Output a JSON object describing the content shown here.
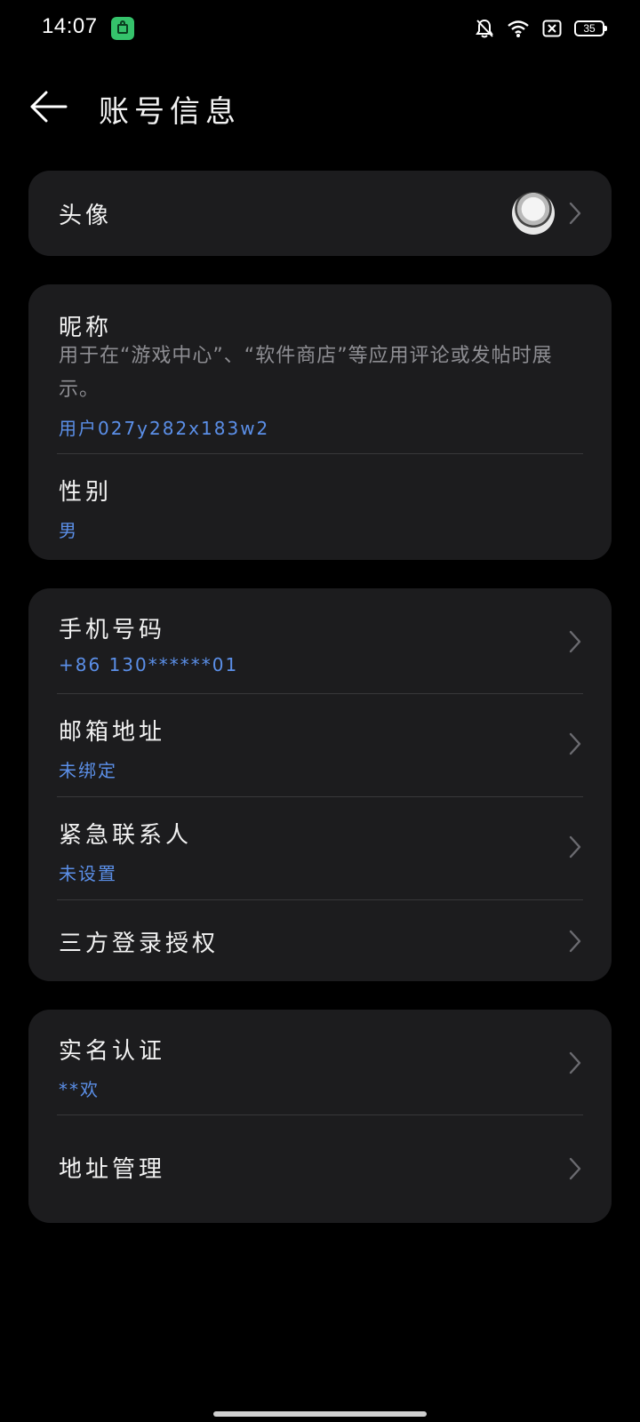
{
  "status_bar": {
    "time": "14:07",
    "battery": "35",
    "icons": [
      "shopping-bag-icon",
      "bell-muted-icon",
      "wifi-icon",
      "sim-cross-icon",
      "battery-icon"
    ]
  },
  "header": {
    "title": "账号信息",
    "back_icon": "arrow-left-icon"
  },
  "cards": {
    "avatar": {
      "label": "头像"
    },
    "nickname": {
      "label": "昵称",
      "description": "用于在“游戏中心”、“软件商店”等应用评论或发帖时展示。",
      "value": "用户027y282x183w2"
    },
    "gender": {
      "label": "性别",
      "value": "男"
    },
    "phone": {
      "label": "手机号码",
      "value": "+86 130******01"
    },
    "email": {
      "label": "邮箱地址",
      "value": "未绑定"
    },
    "emergency": {
      "label": "紧急联系人",
      "value": "未设置"
    },
    "third_party": {
      "label": "三方登录授权"
    },
    "real_name": {
      "label": "实名认证",
      "value": "**欢"
    },
    "address": {
      "label": "地址管理"
    }
  },
  "colors": {
    "background": "#000000",
    "card": "#1c1c1e",
    "accent": "#5b8fe8",
    "secondary_text": "#8e8e93"
  }
}
